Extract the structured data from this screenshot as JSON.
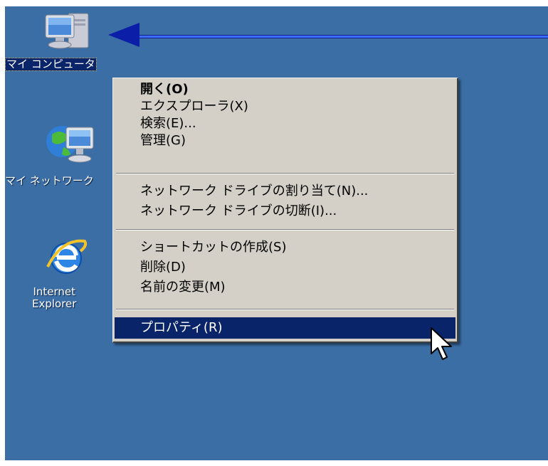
{
  "desktop": {
    "background": "#3a6ea5",
    "icons": [
      {
        "label": "マイ コンピュータ",
        "icon": "my-computer-icon",
        "selected": true
      },
      {
        "label": "マイ ネットワーク",
        "icon": "network-places-icon"
      },
      {
        "label_line1": "Internet",
        "label_line2": "Explorer",
        "icon": "internet-explorer-icon"
      }
    ]
  },
  "context_menu": {
    "items": [
      {
        "label": "開く(O)",
        "bold": true
      },
      {
        "label": "エクスプローラ(X)"
      },
      {
        "label": "検索(E)..."
      },
      {
        "label": "管理(G)"
      },
      {
        "label": "ネットワーク ドライブの割り当て(N)..."
      },
      {
        "label": "ネットワーク ドライブの切断(I)..."
      },
      {
        "label": "ショートカットの作成(S)"
      },
      {
        "label": "削除(D)"
      },
      {
        "label": "名前の変更(M)"
      },
      {
        "label": "プロパティ(R)",
        "selected": true
      }
    ],
    "highlight_color": "#0a246a"
  },
  "annotation": {
    "icon": "arrow-left-icon",
    "color": "#0a1ea8"
  },
  "pointer": {
    "icon": "mouse-pointer-icon"
  }
}
